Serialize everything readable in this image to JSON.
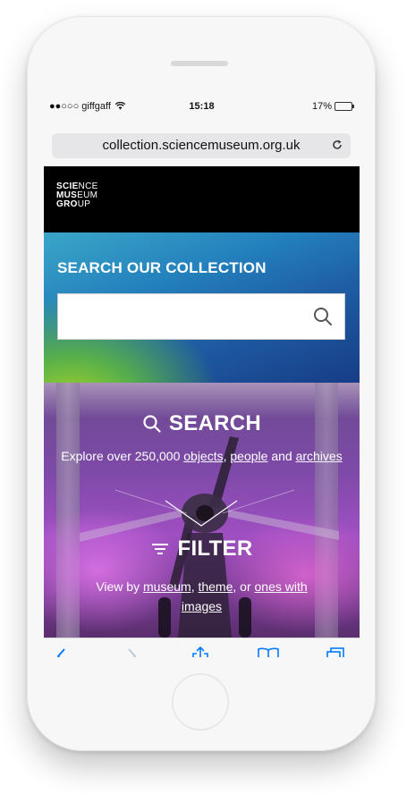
{
  "status_bar": {
    "carrier": "●●○○○ giffgaff",
    "time": "15:18",
    "battery": "17%",
    "battery_level": 0.17
  },
  "browser": {
    "url": "collection.sciencemuseum.org.uk",
    "reload_icon": "reload-icon"
  },
  "logo": {
    "line1_bold": "SCIE",
    "line1_thin": "NCE",
    "line2_bold": "MUS",
    "line2_thin": "EUM",
    "line3_bold": "GRO",
    "line3_thin": "UP"
  },
  "search_panel": {
    "title": "SEARCH OUR COLLECTION",
    "input_value": "",
    "icon": "search-icon"
  },
  "hero": {
    "search_heading": "SEARCH",
    "search_text_prefix": "Explore over 250,000 ",
    "link_objects": "objects",
    "sep1": ", ",
    "link_people": "people",
    "sep2": " and ",
    "link_archives": "archives",
    "filter_heading": "FILTER",
    "filter_text_prefix": "View by ",
    "link_museum": "museum",
    "sep3": ", ",
    "link_theme": "theme",
    "sep4": ", or ",
    "link_ones_with": "ones with",
    "link_images": "images"
  },
  "toolbar": {
    "icons": [
      "back-icon",
      "forward-icon",
      "share-icon",
      "bookmarks-icon",
      "tabs-icon"
    ]
  },
  "colors": {
    "accent": "#007aff",
    "header_bg": "#000000",
    "panel_gradient_start": "#3aa6c8",
    "panel_gradient_end": "#173d86"
  }
}
